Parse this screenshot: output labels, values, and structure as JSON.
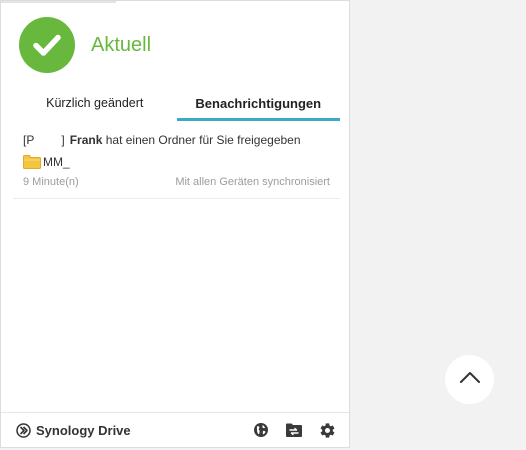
{
  "status": {
    "text": "Aktuell",
    "icon": "check-circle-icon",
    "color": "#67b83c"
  },
  "tabs": [
    {
      "label": "Kürzlich geändert",
      "active": false
    },
    {
      "label": "Benachrichtigungen",
      "active": true
    }
  ],
  "accent_color": "#3ca9c6",
  "notifications": [
    {
      "prefix_open": "[P",
      "prefix_close": "]",
      "user": "Frank",
      "message": "hat einen Ordner für Sie freigegeben",
      "folder_icon": "folder-icon",
      "folder_name": "MM_",
      "time": "9 Minute(n)",
      "sync_status": "Mit allen Geräten synchronisiert"
    }
  ],
  "footer": {
    "brand": "Synology Drive",
    "brand_icon": "synology-drive-logo-icon",
    "icons": [
      "globe-icon",
      "folder-sync-icon",
      "gear-icon"
    ]
  },
  "scroll_top_icon": "chevron-up-icon"
}
